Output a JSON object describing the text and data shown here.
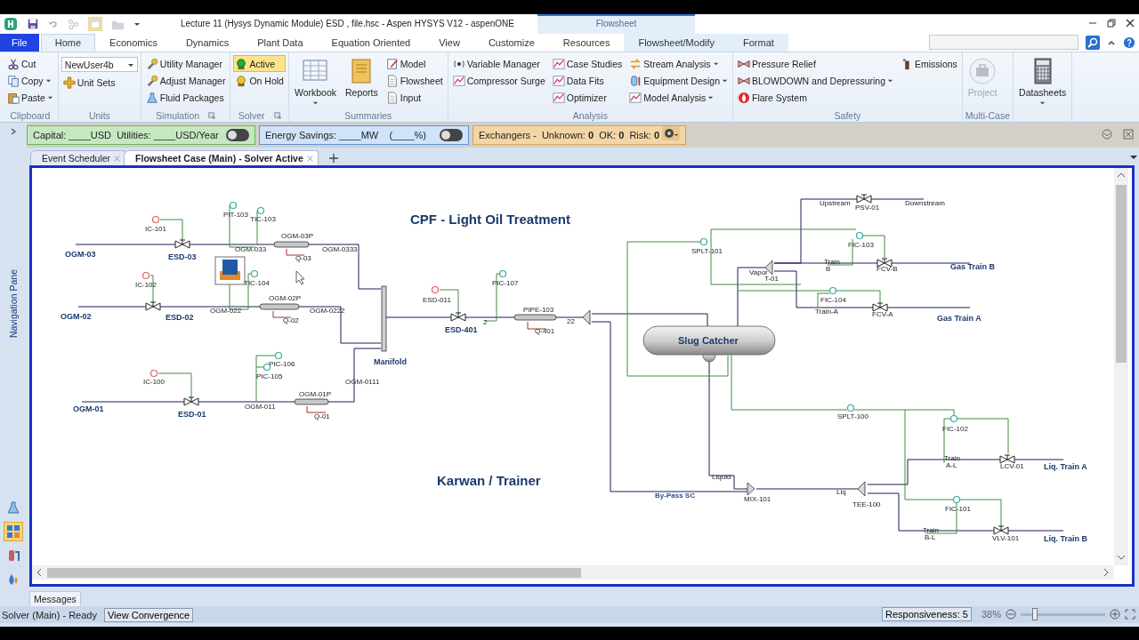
{
  "window": {
    "title": "Lecture 11 (Hysys Dynamic Module) ESD , file.hsc - Aspen HYSYS V12 - aspenONE",
    "context_tab": "Flowsheet"
  },
  "ribbon_tabs": [
    {
      "label": "File",
      "kind": "file",
      "selected": false
    },
    {
      "label": "Home",
      "kind": "normal",
      "selected": true
    },
    {
      "label": "Economics",
      "kind": "normal",
      "selected": false
    },
    {
      "label": "Dynamics",
      "kind": "normal",
      "selected": false
    },
    {
      "label": "Plant Data",
      "kind": "normal",
      "selected": false
    },
    {
      "label": "Equation Oriented",
      "kind": "normal",
      "selected": false
    },
    {
      "label": "View",
      "kind": "normal",
      "selected": false
    },
    {
      "label": "Customize",
      "kind": "normal",
      "selected": false
    },
    {
      "label": "Resources",
      "kind": "normal",
      "selected": false
    },
    {
      "label": "Flowsheet/Modify",
      "kind": "contextual",
      "selected": false
    },
    {
      "label": "Format",
      "kind": "contextual",
      "selected": false
    }
  ],
  "ribbon_groups": [
    {
      "title": "Clipboard",
      "launcher": false,
      "columns": [
        [
          {
            "label": "Cut",
            "kind": "small",
            "dropdown": false,
            "disabled": false
          },
          {
            "label": "Copy",
            "kind": "small",
            "dropdown": true,
            "disabled": false
          },
          {
            "label": "Paste",
            "kind": "small",
            "dropdown": true,
            "disabled": false
          }
        ]
      ]
    },
    {
      "title": "Units",
      "launcher": false,
      "columns": [
        [
          {
            "value": "NewUser4b",
            "kind": "combo",
            "dropdown": true,
            "disabled": false
          },
          {
            "label": "Unit Sets",
            "kind": "small",
            "dropdown": false,
            "disabled": false
          }
        ]
      ]
    },
    {
      "title": "Simulation",
      "launcher": true,
      "columns": [
        [
          {
            "label": "Utility Manager",
            "kind": "small",
            "dropdown": false,
            "disabled": false
          },
          {
            "label": "Adjust Manager",
            "kind": "small",
            "dropdown": false,
            "disabled": false
          },
          {
            "label": "Fluid Packages",
            "kind": "small",
            "dropdown": false,
            "disabled": false
          }
        ]
      ]
    },
    {
      "title": "Solver",
      "launcher": true,
      "columns": [
        [
          {
            "label": "Active",
            "kind": "small",
            "dropdown": false,
            "disabled": false,
            "selected": true
          },
          {
            "label": "On Hold",
            "kind": "small",
            "dropdown": false,
            "disabled": false,
            "selected": false
          }
        ]
      ]
    },
    {
      "title": "Summaries",
      "launcher": false,
      "columns": [
        [
          {
            "label": "Workbook",
            "kind": "large",
            "dropdown": true,
            "disabled": false
          }
        ],
        [
          {
            "label": "Reports",
            "kind": "large",
            "dropdown": false,
            "disabled": false
          }
        ],
        [
          {
            "label": "Model",
            "kind": "small",
            "dropdown": false,
            "disabled": false
          },
          {
            "label": "Flowsheet",
            "kind": "small",
            "dropdown": false,
            "disabled": false
          },
          {
            "label": "Input",
            "kind": "small",
            "dropdown": false,
            "disabled": false
          }
        ]
      ]
    },
    {
      "title": "Analysis",
      "launcher": false,
      "columns": [
        [
          {
            "label": "Variable Manager",
            "kind": "small",
            "dropdown": false,
            "disabled": false
          },
          {
            "label": "Compressor Surge",
            "kind": "small",
            "dropdown": false,
            "disabled": false
          }
        ],
        [
          {
            "label": "Case Studies",
            "kind": "small",
            "dropdown": false,
            "disabled": false
          },
          {
            "label": "Data Fits",
            "kind": "small",
            "dropdown": false,
            "disabled": false
          },
          {
            "label": "Optimizer",
            "kind": "small",
            "dropdown": false,
            "disabled": false
          }
        ],
        [
          {
            "label": "Stream Analysis",
            "kind": "small",
            "dropdown": true,
            "disabled": false
          },
          {
            "label": "Equipment Design",
            "kind": "small",
            "dropdown": true,
            "disabled": false
          },
          {
            "label": "Model Analysis",
            "kind": "small",
            "dropdown": true,
            "disabled": false
          }
        ]
      ]
    },
    {
      "title": "Safety",
      "launcher": false,
      "columns": [
        [
          {
            "label": "Pressure Relief",
            "kind": "small",
            "dropdown": false,
            "disabled": false
          },
          {
            "label": "BLOWDOWN and Depressuring",
            "kind": "small",
            "dropdown": true,
            "disabled": false
          },
          {
            "label": "Flare System",
            "kind": "small",
            "dropdown": false,
            "disabled": false
          }
        ],
        [
          {
            "label": "Emissions",
            "kind": "small",
            "dropdown": false,
            "disabled": false
          }
        ]
      ]
    },
    {
      "title": "Multi-Case",
      "launcher": false,
      "columns": [
        [
          {
            "label": "Project",
            "kind": "large",
            "dropdown": false,
            "disabled": true
          }
        ]
      ]
    },
    {
      "columns": [
        [
          {
            "label": "Datasheets",
            "kind": "large",
            "dropdown": true,
            "disabled": false
          }
        ]
      ]
    }
  ],
  "econ_bar": [
    {
      "kind": "capital",
      "text": "Capital: ____USD  Utilities: ____USD/Year",
      "on": false
    },
    {
      "kind": "energy",
      "text": "Energy Savings: ____MW    (____%)",
      "on": false
    },
    {
      "kind": "exchangers",
      "text": "Exchangers -  Unknown: **0**  OK: **0**  Risk: **0**"
    }
  ],
  "doc_tabs": [
    {
      "label": "Event Scheduler",
      "selected": false
    },
    {
      "label": "Flowsheet Case (Main) - Solver Active",
      "selected": true
    }
  ],
  "nav_pane": {
    "title": "Navigation Pane",
    "tools": [
      {
        "selected": false
      },
      {
        "selected": true
      },
      {
        "selected": false
      },
      {
        "selected": false
      }
    ]
  },
  "flowsheet": {
    "titles": [
      "CPF - Light Oil Treatment",
      "Karwan / Trainer"
    ],
    "labels": [
      {
        "text": "OGM-03",
        "kind": "stream"
      },
      {
        "text": "ESD-03",
        "kind": "stream"
      },
      {
        "text": "OGM-02",
        "kind": "stream"
      },
      {
        "text": "ESD-02",
        "kind": "stream"
      },
      {
        "text": "OGM-01",
        "kind": "stream"
      },
      {
        "text": "ESD-01",
        "kind": "stream"
      },
      {
        "text": "Manifold",
        "kind": "stream"
      },
      {
        "text": "ESD-401",
        "kind": "stream"
      },
      {
        "text": "Gas Train B",
        "kind": "stream"
      },
      {
        "text": "Gas Train A",
        "kind": "stream"
      },
      {
        "text": "Liq. Train A",
        "kind": "stream"
      },
      {
        "text": "Liq. Train B",
        "kind": "stream"
      },
      {
        "text": "By-Pass SC",
        "kind": "note"
      },
      {
        "text": "Slug Catcher",
        "kind": "vessel"
      },
      {
        "text": "OGM-033",
        "kind": "small"
      },
      {
        "text": "OGM-03P",
        "kind": "small"
      },
      {
        "text": "Q-03",
        "kind": "small"
      },
      {
        "text": "OGM-0333",
        "kind": "small"
      },
      {
        "text": "OGM-022",
        "kind": "small"
      },
      {
        "text": "OGM-02P",
        "kind": "small"
      },
      {
        "text": "Q-02",
        "kind": "small"
      },
      {
        "text": "OGM-0222",
        "kind": "small"
      },
      {
        "text": "OGM-011",
        "kind": "small"
      },
      {
        "text": "OGM-01P",
        "kind": "small"
      },
      {
        "text": "Q-01",
        "kind": "small"
      },
      {
        "text": "OGM-0111",
        "kind": "small"
      },
      {
        "text": "PIPE-103",
        "kind": "small"
      },
      {
        "text": "Q-401",
        "kind": "small"
      },
      {
        "text": "2",
        "kind": "small"
      },
      {
        "text": "22",
        "kind": "small"
      },
      {
        "text": "Vapor",
        "kind": "small"
      },
      {
        "text": "T-01",
        "kind": "small"
      },
      {
        "text": "Upstream",
        "kind": "small"
      },
      {
        "text": "PSV-01",
        "kind": "small"
      },
      {
        "text": "Downstream",
        "kind": "small"
      },
      {
        "text": "Train B",
        "kind": "stacked"
      },
      {
        "text": "FCV-B",
        "kind": "small"
      },
      {
        "text": "Train-A",
        "kind": "small"
      },
      {
        "text": "FCV-A",
        "kind": "small"
      },
      {
        "text": "Liquid",
        "kind": "small"
      },
      {
        "text": "MIX-101",
        "kind": "small"
      },
      {
        "text": "Liq",
        "kind": "small"
      },
      {
        "text": "TEE-100",
        "kind": "small"
      },
      {
        "text": "Train A-L",
        "kind": "stacked"
      },
      {
        "text": "LCV-01",
        "kind": "small"
      },
      {
        "text": "Train B-L",
        "kind": "stacked"
      },
      {
        "text": "VLV-101",
        "kind": "small"
      }
    ],
    "controllers": [
      {
        "tag": "IC-101",
        "color": "#e06060"
      },
      {
        "tag": "PIT-103",
        "color": "#3aa8a0"
      },
      {
        "tag": "TIC-103",
        "color": "#3aa8a0"
      },
      {
        "tag": "TIC-104",
        "color": "#3aa8a0"
      },
      {
        "tag": "IC-102",
        "color": "#e06060"
      },
      {
        "tag": "IC-100",
        "color": "#e06060"
      },
      {
        "tag": "PIC-106",
        "color": "#3aa8a0"
      },
      {
        "tag": "PIC-105",
        "color": "#3aa8a0"
      },
      {
        "tag": "ESD-011",
        "color": "#e06060"
      },
      {
        "tag": "PIC-107",
        "color": "#3aa8a0"
      },
      {
        "tag": "SPLT-101",
        "color": "#3aa8a0"
      },
      {
        "tag": "FIC-103",
        "color": "#3aa8a0"
      },
      {
        "tag": "FIC-104",
        "color": "#3aa8a0"
      },
      {
        "tag": "SPLT-100",
        "color": "#3aa8a0"
      },
      {
        "tag": "FIC-102",
        "color": "#3aa8a0"
      },
      {
        "tag": "FIC-101",
        "color": "#3aa8a0"
      }
    ]
  },
  "messages_tab": "Messages",
  "status_bar": {
    "message": "Solver (Main) - Ready",
    "convergence_button": "View Convergence",
    "responsiveness": "Responsiveness: 5",
    "zoom": {
      "reading": "38%",
      "level": 0.17
    }
  }
}
